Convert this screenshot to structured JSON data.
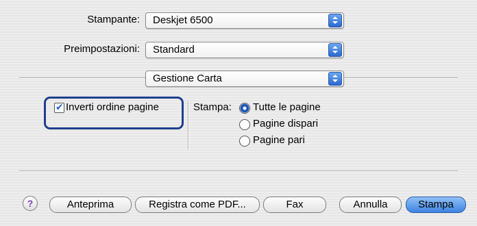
{
  "form": {
    "printer_label": "Stampante:",
    "printer_value": "Deskjet 6500",
    "presets_label": "Preimpostazioni:",
    "presets_value": "Standard",
    "panel_value": "Gestione Carta"
  },
  "options": {
    "reverse_order_label": "Inverti ordine pagine",
    "reverse_order_checked": true,
    "print_label": "Stampa:",
    "radio_items": [
      {
        "label": "Tutte le pagine",
        "selected": true
      },
      {
        "label": "Pagine dispari",
        "selected": false
      },
      {
        "label": "Pagine pari",
        "selected": false
      }
    ]
  },
  "footer": {
    "help_glyph": "?",
    "preview_label": "Anteprima",
    "save_pdf_label": "Registra come PDF...",
    "fax_label": "Fax",
    "cancel_label": "Annulla",
    "print_label": "Stampa"
  },
  "colors": {
    "highlight_border": "#1e3f8c",
    "accent_blue": "#3d83e1"
  }
}
